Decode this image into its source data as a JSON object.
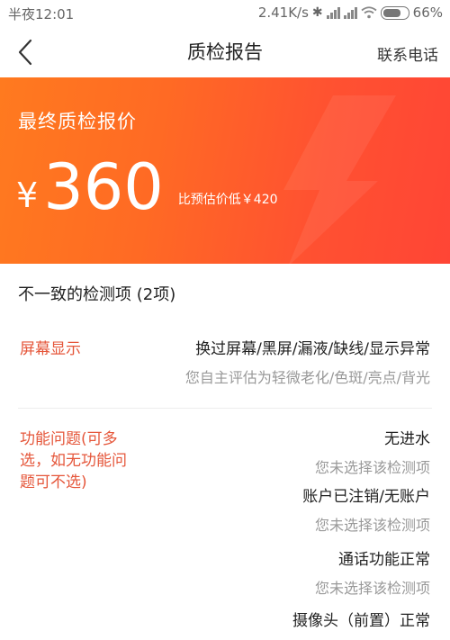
{
  "status_bar": {
    "time": "半夜12:01",
    "network_speed": "2.41K/s",
    "battery": "66%",
    "icons": [
      "bluetooth-icon",
      "signal-icon",
      "signal-icon",
      "wifi-icon",
      "battery-icon"
    ]
  },
  "nav": {
    "title": "质检报告",
    "action": "联系电话",
    "back_icon": "chevron-left-icon"
  },
  "banner": {
    "label": "最终质检报价",
    "currency": "¥",
    "price": "360",
    "compare_text": "比预估价低￥420",
    "colors": {
      "start": "#ff7a1f",
      "end": "#ff4535"
    }
  },
  "inconsistent": {
    "header": "不一致的检测项 (2项)",
    "groups": [
      {
        "category": "屏幕显示",
        "items": [
          {
            "result": "换过屏幕/黑屏/漏液/缺线/显示异常",
            "self_eval": "您自主评估为轻微老化/色斑/亮点/背光"
          }
        ]
      },
      {
        "category": "功能问题(可多选，如无功能问题可不选)",
        "items": [
          {
            "result": "无进水",
            "self_eval": "您未选择该检测项"
          },
          {
            "result": "账户已注销/无账户",
            "self_eval": "您未选择该检测项"
          },
          {
            "result": "通话功能正常",
            "self_eval": "您未选择该检测项"
          },
          {
            "result": "摄像头（前置）正常",
            "self_eval": ""
          }
        ]
      }
    ]
  },
  "accent_color": "#e5563a"
}
